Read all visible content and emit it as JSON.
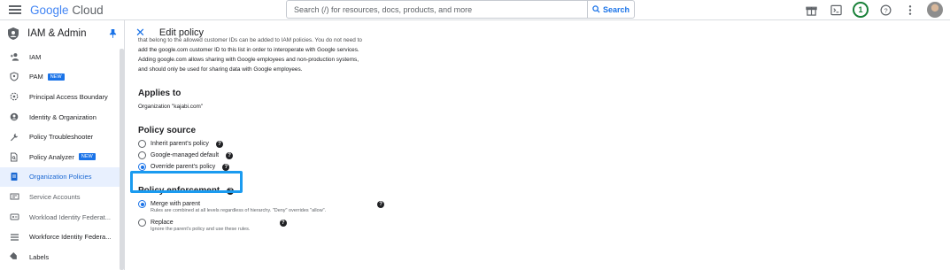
{
  "header": {
    "logo_google": "Google",
    "logo_cloud": "Cloud",
    "search_placeholder": "Search (/) for resources, docs, products, and more",
    "search_button": "Search",
    "notification_count": "1"
  },
  "sidebar": {
    "title": "IAM & Admin",
    "items": [
      {
        "label": "IAM",
        "icon": "add-person-icon"
      },
      {
        "label": "PAM",
        "badge": "NEW",
        "icon": "shield-person-icon"
      },
      {
        "label": "Principal Access Boundary",
        "icon": "boundary-icon"
      },
      {
        "label": "Identity & Organization",
        "icon": "account-circle-icon"
      },
      {
        "label": "Policy Troubleshooter",
        "icon": "wrench-icon"
      },
      {
        "label": "Policy Analyzer",
        "badge": "NEW",
        "icon": "document-search-icon"
      },
      {
        "label": "Organization Policies",
        "icon": "policy-doc-icon",
        "active": true
      },
      {
        "label": "Service Accounts",
        "icon": "service-account-icon"
      },
      {
        "label": "Workload Identity Federat...",
        "icon": "workload-icon"
      },
      {
        "label": "Workforce Identity Federa...",
        "icon": "list-icon"
      },
      {
        "label": "Labels",
        "icon": "label-icon"
      }
    ]
  },
  "main": {
    "title": "Edit policy",
    "intro_lines": [
      "that belong to the allowed customer IDs can be added to IAM policies. You do not need to",
      "add the google.com customer ID to this list in order to interoperate with Google services.",
      "Adding google.com allows sharing with Google employees and non-production systems,",
      "and should only be used for sharing data with Google employees."
    ],
    "applies_to_heading": "Applies to",
    "applies_to_value": "Organization \"kajabi.com\"",
    "policy_source_heading": "Policy source",
    "policy_source_options": [
      {
        "label": "Inherit parent's policy",
        "selected": false
      },
      {
        "label": "Google-managed default",
        "selected": false
      },
      {
        "label": "Override parent's policy",
        "selected": true
      }
    ],
    "enforcement_heading": "Policy enforcement",
    "enforcement_options": [
      {
        "label": "Merge with parent",
        "desc": "Rules are combined at all levels regardless of hierarchy. \"Deny\" overrides \"allow\".",
        "selected": true
      },
      {
        "label": "Replace",
        "desc": "Ignore the parent's policy and use these rules.",
        "selected": false
      }
    ]
  },
  "colors": {
    "accent": "#1a73e8",
    "highlight": "#1a9bf0",
    "active_bg": "#e8f0fe"
  }
}
